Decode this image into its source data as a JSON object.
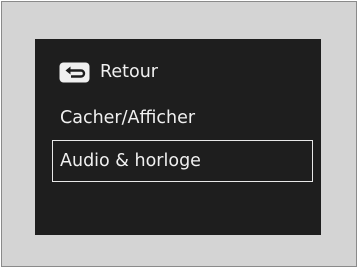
{
  "menu": {
    "back": {
      "icon": "back-arrow-icon",
      "label": "Retour"
    },
    "items": [
      {
        "label": "Cacher/Afficher"
      },
      {
        "label": "Audio & horloge",
        "selected": true
      }
    ]
  },
  "colors": {
    "screen_background": "#1e1e1e",
    "outer_background": "#d4d4d4",
    "text": "#f0f0f0",
    "selection_border": "#e8e8e8"
  }
}
